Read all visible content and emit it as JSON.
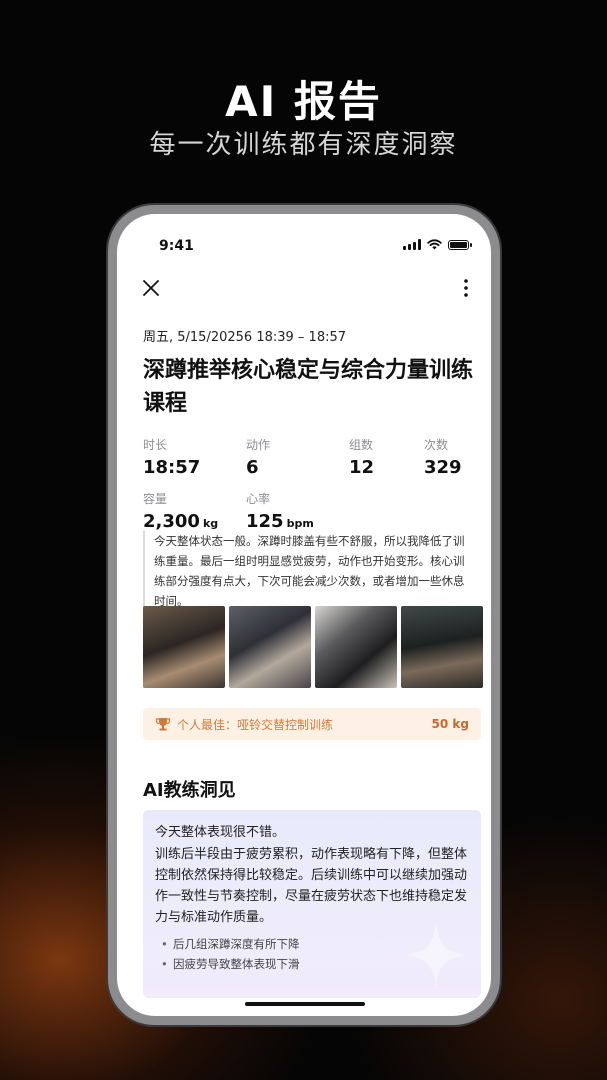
{
  "promo": {
    "title": "AI 报告",
    "subtitle": "每一次训练都有深度洞察"
  },
  "status_bar": {
    "time": "9:41",
    "icons": [
      "signal-icon",
      "wifi-icon",
      "battery-icon"
    ]
  },
  "nav": {
    "close_icon": "close-icon",
    "more_icon": "more-vertical-icon"
  },
  "workout": {
    "datetime": "周五, 5/15/20256 18:39 – 18:57",
    "title": "深蹲推举核心稳定与综合力量训练课程",
    "stats": [
      {
        "label": "时长",
        "value": "18:57",
        "unit": ""
      },
      {
        "label": "动作",
        "value": "6",
        "unit": ""
      },
      {
        "label": "组数",
        "value": "12",
        "unit": ""
      },
      {
        "label": "次数",
        "value": "329",
        "unit": ""
      },
      {
        "label": "容量",
        "value": "2,300",
        "unit": "kg"
      },
      {
        "label": "心率",
        "value": "125",
        "unit": "bpm"
      }
    ],
    "note": "今天整体状态一般。深蹲时膝盖有些不舒服，所以我降低了训练重量。最后一组时明显感觉疲劳，动作也开始变形。核心训练部分强度有点大，下次可能会减少次数，或者增加一些休息时间。",
    "personal_best": {
      "icon": "trophy-icon",
      "label": "个人最佳：哑铃交替控制训练",
      "value": "50 kg"
    }
  },
  "ai_insight": {
    "section_title": "AI教练洞见",
    "headline": "今天整体表现很不错。",
    "body": "训练后半段由于疲劳累积，动作表现略有下降，但整体控制依然保持得比较稳定。后续训练中可以继续加强动作一致性与节奏控制，尽量在疲劳状态下也维持稳定发力与标准动作质量。",
    "bullets": [
      "后几组深蹲深度有所下降",
      "因疲劳导致整体表现下滑"
    ]
  },
  "colors": {
    "accent": "#c56a2c",
    "best_bg": "#fdf1e6",
    "insight_bg": "#e8eafb"
  }
}
